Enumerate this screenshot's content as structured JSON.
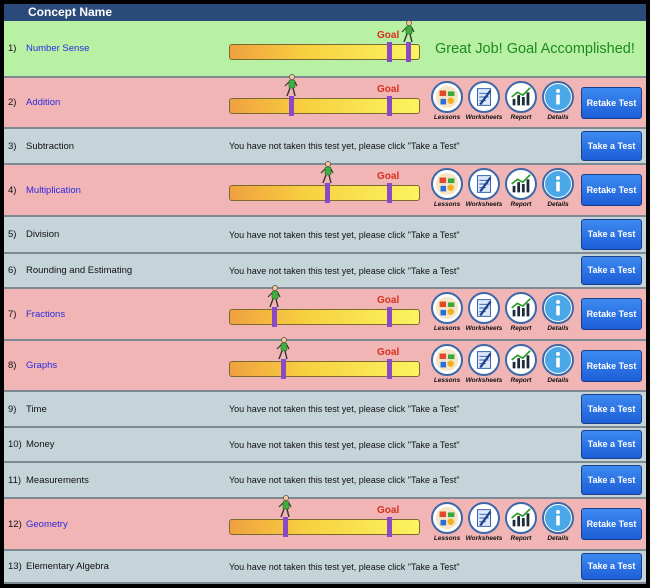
{
  "header": {
    "title": "Concept Name"
  },
  "goal_label": "Goal",
  "great_message": "Great Job! Goal Accomplished!",
  "not_taken_message": "You have not taken this test yet, please click \"Take a Test\"",
  "icon_labels": {
    "lessons": "Lessons",
    "worksheets": "Worksheets",
    "report": "Report",
    "details": "Details"
  },
  "buttons": {
    "retake": "Retake Test",
    "take": "Take a Test"
  },
  "colors": {
    "header": "#2a4a7a",
    "accomplished_row": "#b8f0a4",
    "taken_row": "#f2b5b5",
    "pending_row": "#c5d4d8",
    "link": "#2a2ae0",
    "goal": "#d83020",
    "marker": "#8a4ac8",
    "great": "#1d8a1d",
    "button": "#2a6ee0"
  },
  "concepts": [
    {
      "number": "1)",
      "name": "Number Sense",
      "status": "accomplished",
      "progress": 0.93,
      "goal": 0.83
    },
    {
      "number": "2)",
      "name": "Addition",
      "status": "taken",
      "progress": 0.32,
      "goal": 0.83
    },
    {
      "number": "3)",
      "name": "Subtraction",
      "status": "not_taken"
    },
    {
      "number": "4)",
      "name": "Multiplication",
      "status": "taken",
      "progress": 0.51,
      "goal": 0.83
    },
    {
      "number": "5)",
      "name": "Division",
      "status": "not_taken"
    },
    {
      "number": "6)",
      "name": "Rounding and Estimating",
      "status": "not_taken"
    },
    {
      "number": "7)",
      "name": "Fractions",
      "status": "taken",
      "progress": 0.23,
      "goal": 0.83
    },
    {
      "number": "8)",
      "name": "Graphs",
      "status": "taken",
      "progress": 0.28,
      "goal": 0.83
    },
    {
      "number": "9)",
      "name": "Time",
      "status": "not_taken"
    },
    {
      "number": "10)",
      "name": "Money",
      "status": "not_taken"
    },
    {
      "number": "11)",
      "name": "Measurements",
      "status": "not_taken"
    },
    {
      "number": "12)",
      "name": "Geometry",
      "status": "taken",
      "progress": 0.29,
      "goal": 0.83
    },
    {
      "number": "13)",
      "name": "Elementary Algebra",
      "status": "not_taken"
    }
  ]
}
